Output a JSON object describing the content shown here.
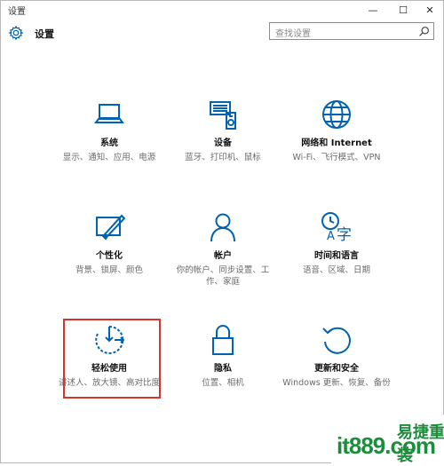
{
  "window": {
    "title": "设置"
  },
  "window_controls": {
    "minimize": "—",
    "maximize": "☐",
    "close": "✕"
  },
  "header": {
    "title": "设置",
    "search_placeholder": "查找设置"
  },
  "tiles": [
    {
      "label": "系统",
      "desc": "显示、通知、应用、电源",
      "icon": "laptop-icon"
    },
    {
      "label": "设备",
      "desc": "蓝牙、打印机、鼠标",
      "icon": "devices-icon"
    },
    {
      "label": "网络和 Internet",
      "desc": "Wi-Fi、飞行模式、VPN",
      "icon": "globe-icon"
    },
    {
      "label": "个性化",
      "desc": "背景、锁屏、颜色",
      "icon": "brush-icon"
    },
    {
      "label": "帐户",
      "desc": "你的帐户、同步设置、工作、家庭",
      "icon": "person-icon"
    },
    {
      "label": "时间和语言",
      "desc": "语音、区域、日期",
      "icon": "clock-language-icon"
    },
    {
      "label": "轻松使用",
      "desc": "讲述人、放大镜、高对比度",
      "icon": "ease-of-access-icon"
    },
    {
      "label": "隐私",
      "desc": "位置、相机",
      "icon": "lock-icon"
    },
    {
      "label": "更新和安全",
      "desc": "Windows 更新、恢复、备份",
      "icon": "refresh-icon"
    }
  ],
  "watermark": {
    "text": "it889.com",
    "cn": "易捷重装",
    "sub": ""
  },
  "colors": {
    "accent": "#0063b1",
    "highlight_border": "#d9342b",
    "watermark": "#1c8d3a"
  }
}
